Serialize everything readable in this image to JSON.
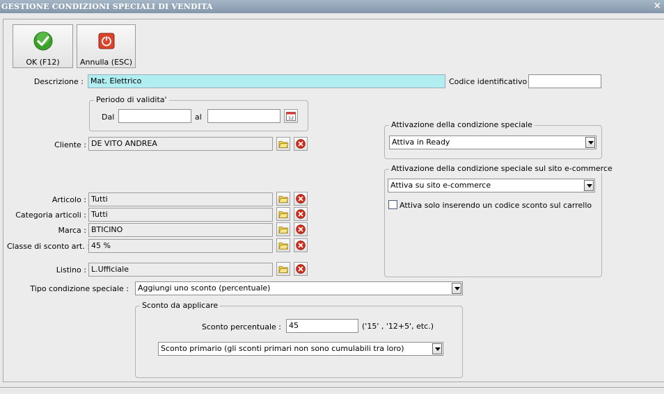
{
  "window": {
    "title": "GESTIONE CONDIZIONI SPECIALI DI VENDITA",
    "close": "×"
  },
  "toolbar": {
    "ok_label": "OK (F12)",
    "cancel_label": "Annulla (ESC)"
  },
  "form": {
    "descrizione_label": "Descrizione :",
    "descrizione_value": "Mat. Elettrico",
    "codice_label": "Codice identificativo :",
    "codice_value": "",
    "periodo": {
      "legend": "Periodo di validita'",
      "dal_label": "Dal",
      "dal_value": "",
      "al_label": "al",
      "al_value": ""
    },
    "cliente_label": "Cliente :",
    "cliente_value": "DE VITO ANDREA",
    "articolo_label": "Articolo :",
    "articolo_value": "Tutti",
    "categoria_label": "Categoria articoli :",
    "categoria_value": "Tutti",
    "marca_label": "Marca :",
    "marca_value": "BTICINO",
    "classe_label": "Classe di sconto art. :",
    "classe_value": "45 %",
    "listino_label": "Listino :",
    "listino_value": "L.Ufficiale",
    "tipo_label": "Tipo condizione speciale :",
    "tipo_value": "Aggiungi uno sconto (percentuale)",
    "sconto": {
      "legend": "Sconto da applicare",
      "percentuale_label": "Sconto percentuale :",
      "percentuale_value": "45",
      "hint": "('15' , '12+5', etc.)",
      "tipo_value": "Sconto primario (gli sconti primari non sono cumulabili tra loro)"
    }
  },
  "attivazione": {
    "legend": "Attivazione della condizione speciale",
    "value": "Attiva in Ready"
  },
  "attivazione_web": {
    "legend": "Attivazione della condizione speciale sul sito e-commerce",
    "value": "Attiva su sito e-commerce",
    "checkbox_label": "Attiva solo inserendo un codice sconto sul carrello",
    "checkbox_checked": false
  },
  "colors": {
    "accent_cyan": "#b0eef2",
    "ok_green": "#3aa12a",
    "cancel_red": "#d8452c",
    "delete_red": "#d62c1a",
    "folder_yellow": "#f2d24a"
  }
}
